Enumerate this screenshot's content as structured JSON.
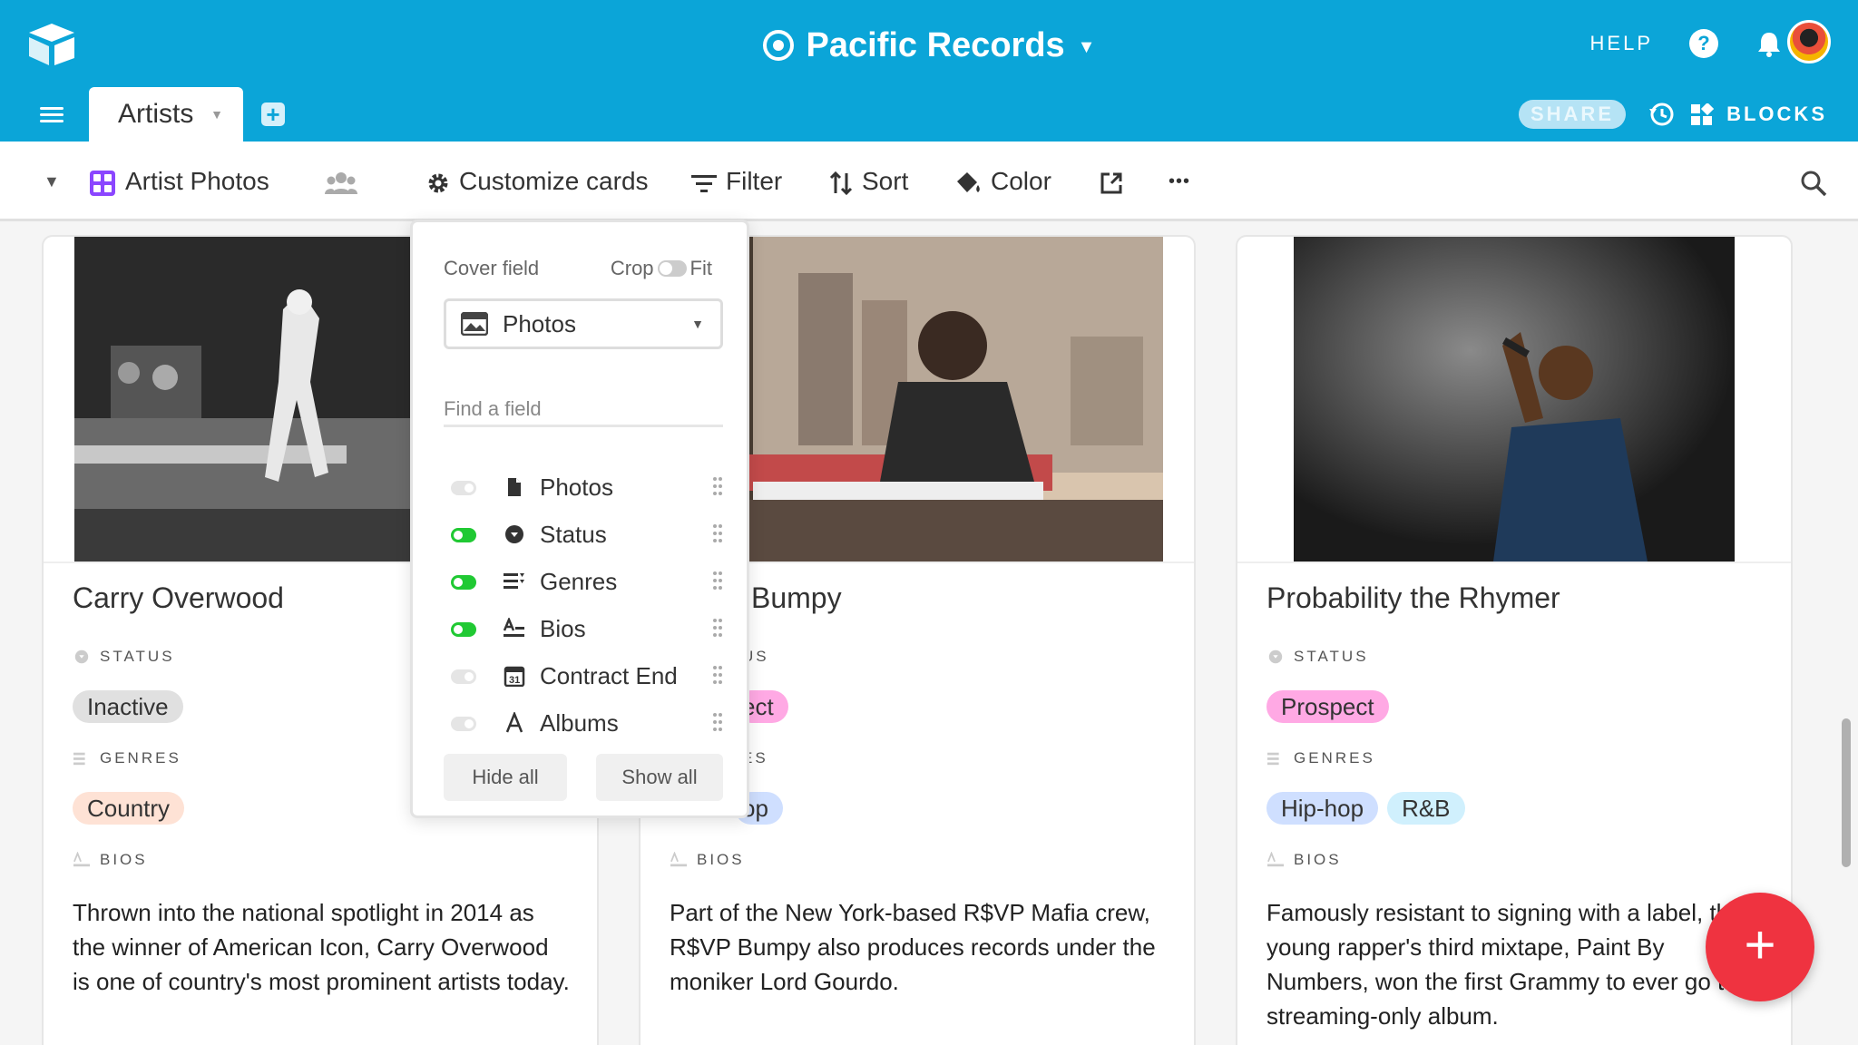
{
  "header": {
    "base_name": "Pacific Records",
    "help_label": "HELP",
    "help_glyph": "?",
    "share_label": "SHARE",
    "blocks_label": "BLOCKS",
    "brand_color": "#0ba5d8"
  },
  "tabs": {
    "active_table": "Artists",
    "add_glyph": "+"
  },
  "viewbar": {
    "view_name": "Artist Photos",
    "customize_label": "Customize cards",
    "filter_label": "Filter",
    "sort_label": "Sort",
    "color_label": "Color",
    "more_glyph": "•••"
  },
  "popup": {
    "cover_field_label": "Cover field",
    "crop_label": "Crop",
    "fit_label": "Fit",
    "cover_selected": "Photos",
    "find_placeholder": "Find a field",
    "fields": [
      {
        "name": "Photos",
        "visible": false,
        "icon": "attachment-icon"
      },
      {
        "name": "Status",
        "visible": true,
        "icon": "single-select-icon"
      },
      {
        "name": "Genres",
        "visible": true,
        "icon": "multi-select-icon"
      },
      {
        "name": "Bios",
        "visible": true,
        "icon": "long-text-icon"
      },
      {
        "name": "Contract End",
        "visible": false,
        "icon": "date-icon"
      },
      {
        "name": "Albums",
        "visible": false,
        "icon": "text-icon"
      }
    ],
    "hide_all_label": "Hide all",
    "show_all_label": "Show all"
  },
  "cards": [
    {
      "name": "Carry Overwood",
      "status_label": "STATUS",
      "status": "Inactive",
      "genres_label": "GENRES",
      "genres": [
        "Country"
      ],
      "bios_label": "BIOS",
      "bio": "Thrown into the national spotlight in 2014 as the winner of American Icon, Carry Overwood is one of country's most prominent artists today."
    },
    {
      "name": "Bumpy",
      "status_label": "US",
      "status": "ect",
      "genres_label": "ES",
      "genres": [
        "op"
      ],
      "bios_label": "BIOS",
      "bio": "Part of the New York-based R$VP Mafia crew, R$VP Bumpy also produces records under the moniker Lord Gourdo."
    },
    {
      "name": "Probability the Rhymer",
      "status_label": "STATUS",
      "status": "Prospect",
      "genres_label": "GENRES",
      "genres": [
        "Hip-hop",
        "R&B"
      ],
      "bios_label": "BIOS",
      "bio": "Famously resistant to signing with a label, this young rapper's third mixtape, Paint By Numbers, won the first Grammy to ever go to a streaming-only album."
    }
  ],
  "fab_glyph": "+"
}
